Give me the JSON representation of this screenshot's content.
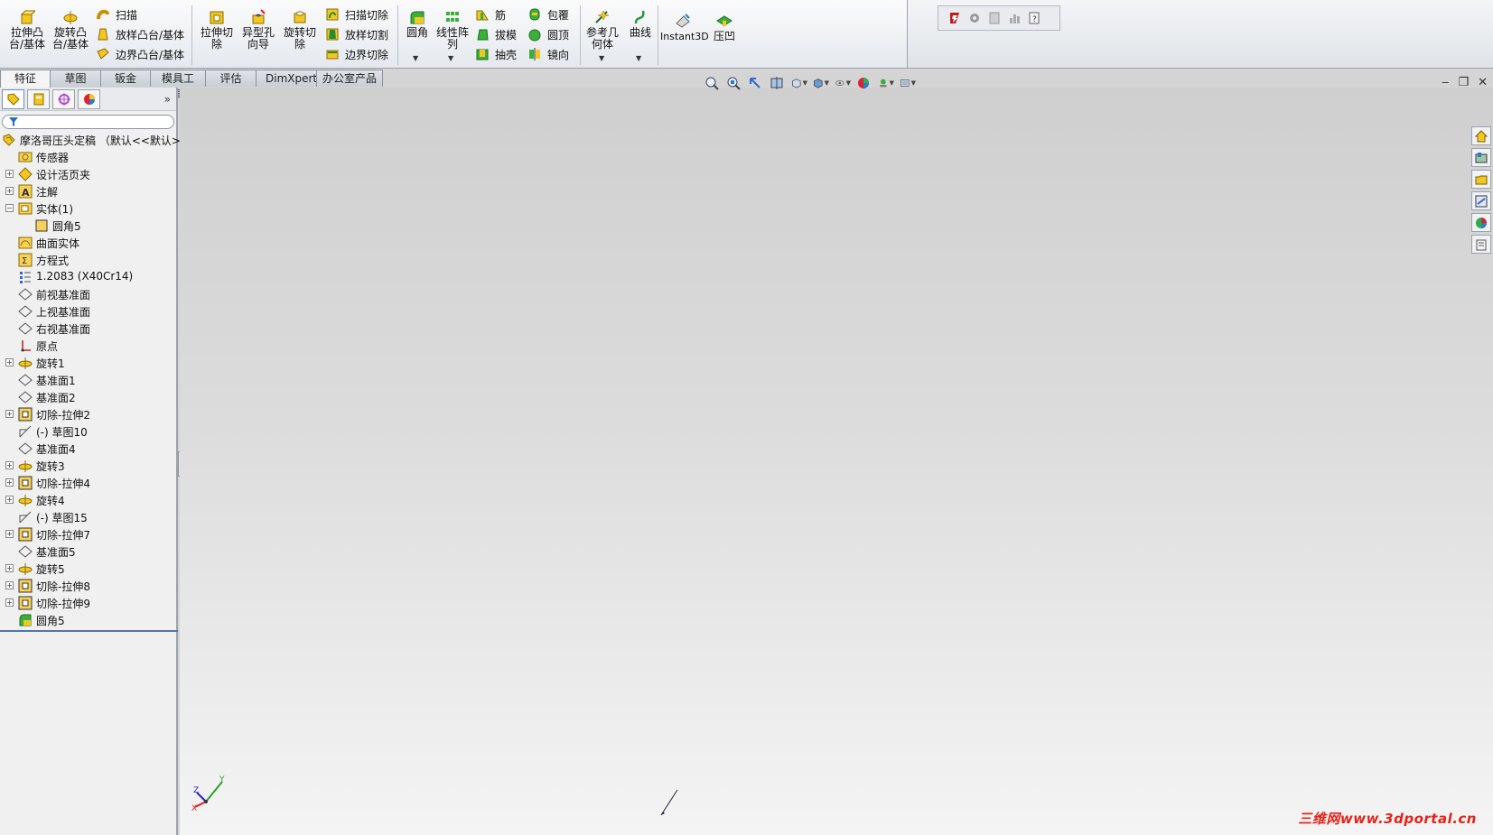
{
  "command_manager": {
    "extrude_boss": "拉伸凸\n台/基体",
    "revolve_boss": "旋转凸\n台/基体",
    "sweep": "扫描",
    "loft_boss": "放样凸台/基体",
    "boundary_boss": "边界凸台/基体",
    "extrude_cut": "拉伸切\n除",
    "hole_wizard": "异型孔\n向导",
    "revolve_cut": "旋转切\n除",
    "swept_cut": "扫描切除",
    "lofted_cut": "放样切割",
    "boundary_cut": "边界切除",
    "fillet": "圆角",
    "linear_pattern": "线性阵\n列",
    "rib": "筋",
    "draft": "拔模",
    "shell": "抽壳",
    "wrap": "包覆",
    "dome": "圆顶",
    "mirror": "镜向",
    "reference_geometry": "参考几\n何体",
    "curves": "曲线",
    "instant3d": "Instant3D",
    "indent": "压凹"
  },
  "tabs": [
    "特征",
    "草图",
    "钣金",
    "模具工具",
    "评估",
    "DimXpert",
    "办公室产品"
  ],
  "tree": {
    "root": "摩洛哥压头定稿 （默认<<默认>_",
    "items": [
      {
        "label": "传感器",
        "icon": "sensor-icon",
        "expand": "",
        "indent": 0
      },
      {
        "label": "设计活页夹",
        "icon": "design-binder-icon",
        "expand": "+",
        "indent": 0
      },
      {
        "label": "注解",
        "icon": "annotations-icon",
        "expand": "+",
        "indent": 0
      },
      {
        "label": "实体(1)",
        "icon": "solid-bodies-icon",
        "expand": "-",
        "indent": 0
      },
      {
        "label": "圆角5",
        "icon": "body-icon",
        "expand": "",
        "indent": 1
      },
      {
        "label": "曲面实体",
        "icon": "surface-bodies-icon",
        "expand": "",
        "indent": 0
      },
      {
        "label": "方程式",
        "icon": "equations-icon",
        "expand": "",
        "indent": 0
      },
      {
        "label": "1.2083 (X40Cr14)",
        "icon": "material-icon",
        "expand": "",
        "indent": 0
      },
      {
        "label": "前视基准面",
        "icon": "plane-icon",
        "expand": "",
        "indent": 0
      },
      {
        "label": "上视基准面",
        "icon": "plane-icon",
        "expand": "",
        "indent": 0
      },
      {
        "label": "右视基准面",
        "icon": "plane-icon",
        "expand": "",
        "indent": 0
      },
      {
        "label": "原点",
        "icon": "origin-icon",
        "expand": "",
        "indent": 0
      },
      {
        "label": "旋转1",
        "icon": "revolve-icon",
        "expand": "+",
        "indent": 0
      },
      {
        "label": "基准面1",
        "icon": "plane-icon",
        "expand": "",
        "indent": 0
      },
      {
        "label": "基准面2",
        "icon": "plane-icon",
        "expand": "",
        "indent": 0
      },
      {
        "label": "切除-拉伸2",
        "icon": "cut-extrude-icon",
        "expand": "+",
        "indent": 0
      },
      {
        "label": "(-) 草图10",
        "icon": "sketch-icon",
        "expand": "",
        "indent": 0
      },
      {
        "label": "基准面4",
        "icon": "plane-icon",
        "expand": "",
        "indent": 0
      },
      {
        "label": "旋转3",
        "icon": "revolve-icon",
        "expand": "+",
        "indent": 0
      },
      {
        "label": "切除-拉伸4",
        "icon": "cut-extrude-icon",
        "expand": "+",
        "indent": 0
      },
      {
        "label": "旋转4",
        "icon": "revolve-icon",
        "expand": "+",
        "indent": 0
      },
      {
        "label": "(-) 草图15",
        "icon": "sketch-icon",
        "expand": "",
        "indent": 0
      },
      {
        "label": "切除-拉伸7",
        "icon": "cut-extrude-icon",
        "expand": "+",
        "indent": 0
      },
      {
        "label": "基准面5",
        "icon": "plane-icon",
        "expand": "",
        "indent": 0
      },
      {
        "label": "旋转5",
        "icon": "revolve-icon",
        "expand": "+",
        "indent": 0
      },
      {
        "label": "切除-拉伸8",
        "icon": "cut-extrude-icon",
        "expand": "+",
        "indent": 0
      },
      {
        "label": "切除-拉伸9",
        "icon": "cut-extrude-icon",
        "expand": "+",
        "indent": 0
      },
      {
        "label": "圆角5",
        "icon": "fillet-feature-icon",
        "expand": "",
        "indent": 0
      }
    ]
  },
  "triad": {
    "x": "X",
    "y": "Y",
    "z": "Z"
  },
  "watermark": "三维网www.3dportal.cn"
}
